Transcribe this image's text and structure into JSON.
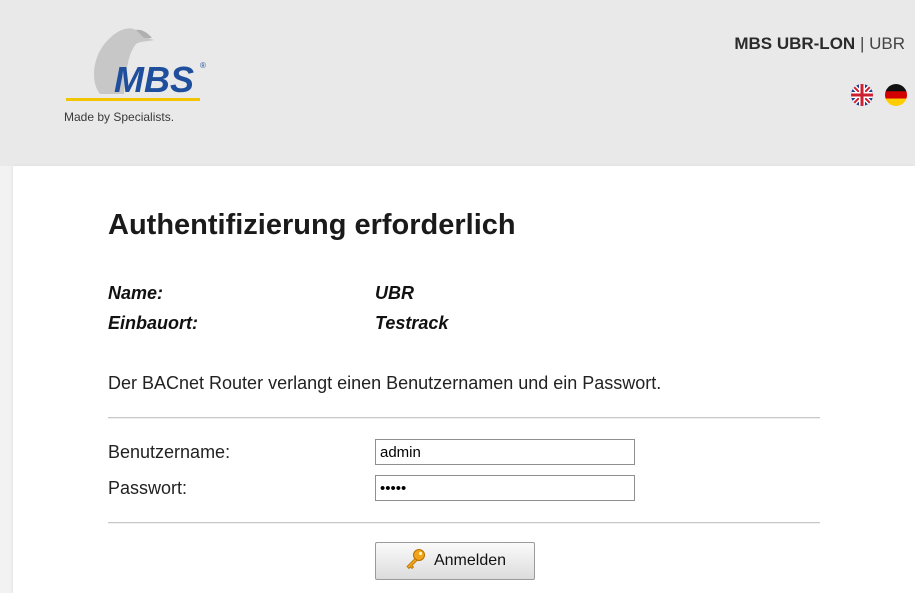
{
  "header": {
    "logo": {
      "brand": "MBS",
      "tagline": "Made by Specialists.",
      "icon": "penguin-bird-logo"
    },
    "product": {
      "name": "MBS UBR-LON",
      "separator": "|",
      "model": "UBR"
    },
    "languages": [
      {
        "icon": "uk-flag-icon",
        "code": "en"
      },
      {
        "icon": "german-flag-icon",
        "code": "de"
      }
    ]
  },
  "main": {
    "title": "Authentifizierung erforderlich",
    "info": [
      {
        "label": "Name:",
        "value": "UBR"
      },
      {
        "label": "Einbauort:",
        "value": "Testrack"
      }
    ],
    "description": "Der BACnet Router verlangt einen Benutzernamen und ein Passwort.",
    "form": {
      "username_label": "Benutzername:",
      "username_value": "admin",
      "password_label": "Passwort:",
      "password_value": "admin",
      "submit_label": "Anmelden",
      "submit_icon": "key-icon"
    }
  },
  "colors": {
    "brand_blue": "#1f4f9c",
    "brand_yellow": "#f2c500",
    "header_bg": "#e9e9e9",
    "panel_bg": "#ffffff"
  }
}
